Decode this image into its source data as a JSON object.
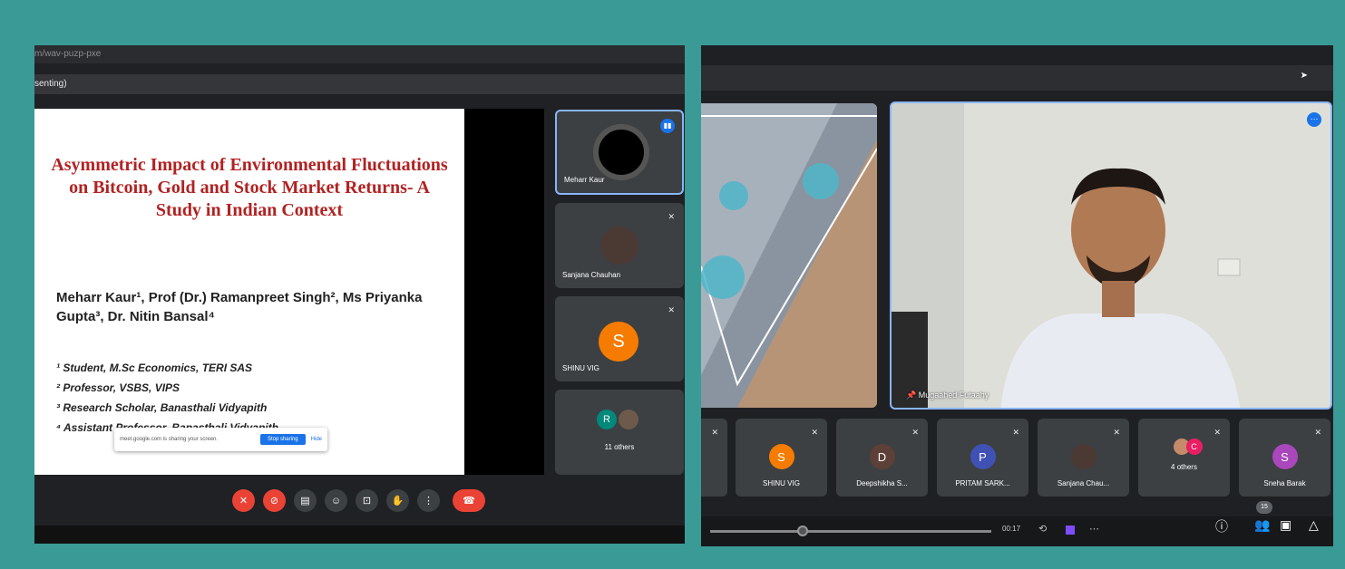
{
  "left": {
    "url": "m/wav-puzp-pxe",
    "presenting_label": "senting)",
    "slide": {
      "title": "Asymmetric Impact of Environmental Fluctuations on Bitcoin, Gold and Stock Market Returns- A Study in Indian Context",
      "authors": "Meharr Kaur¹, Prof (Dr.) Ramanpreet Singh², Ms Priyanka Gupta³, Dr. Nitin Bansal⁴",
      "affiliations": [
        "¹ Student, M.Sc Economics, TERI SAS",
        "² Professor, VSBS, VIPS",
        "³ Research Scholar, Banasthali Vidyapith",
        "⁴ Assistant Professor, Banasthali Vidyapith"
      ]
    },
    "share_notice": {
      "text": "meet.google.com is sharing your screen.",
      "stop_label": "Stop sharing",
      "hide_label": "Hide"
    },
    "participants": [
      {
        "name": "Meharr Kaur"
      },
      {
        "name": "Sanjana Chauhan"
      },
      {
        "name": "SHINU VIG",
        "initial": "S",
        "color": "#f57c00"
      },
      {
        "name": "11 others",
        "initial": "R",
        "color": "#00897b"
      }
    ],
    "controls": [
      "mic-off",
      "camera-off",
      "captions",
      "emoji",
      "present",
      "raise-hand",
      "more",
      "end-call"
    ]
  },
  "right": {
    "main_speaker": "Mugaahed Futaahy",
    "tiles": [
      {
        "name": "SHINU VIG",
        "initial": "S",
        "color": "#f57c00"
      },
      {
        "name": "Deepshikha S...",
        "initial": "D",
        "color": "#5d4037"
      },
      {
        "name": "PRITAM SARK...",
        "initial": "P",
        "color": "#3f51b5"
      },
      {
        "name": "Sanjana Chau..."
      },
      {
        "name": "4 others",
        "initial": "C",
        "color": "#e91e63"
      },
      {
        "name": "Sneha Barak",
        "initial": "S",
        "color": "#ab47bc"
      }
    ],
    "timeline": {
      "time": "00:17",
      "progress": 0.33
    },
    "participant_count": "15"
  }
}
